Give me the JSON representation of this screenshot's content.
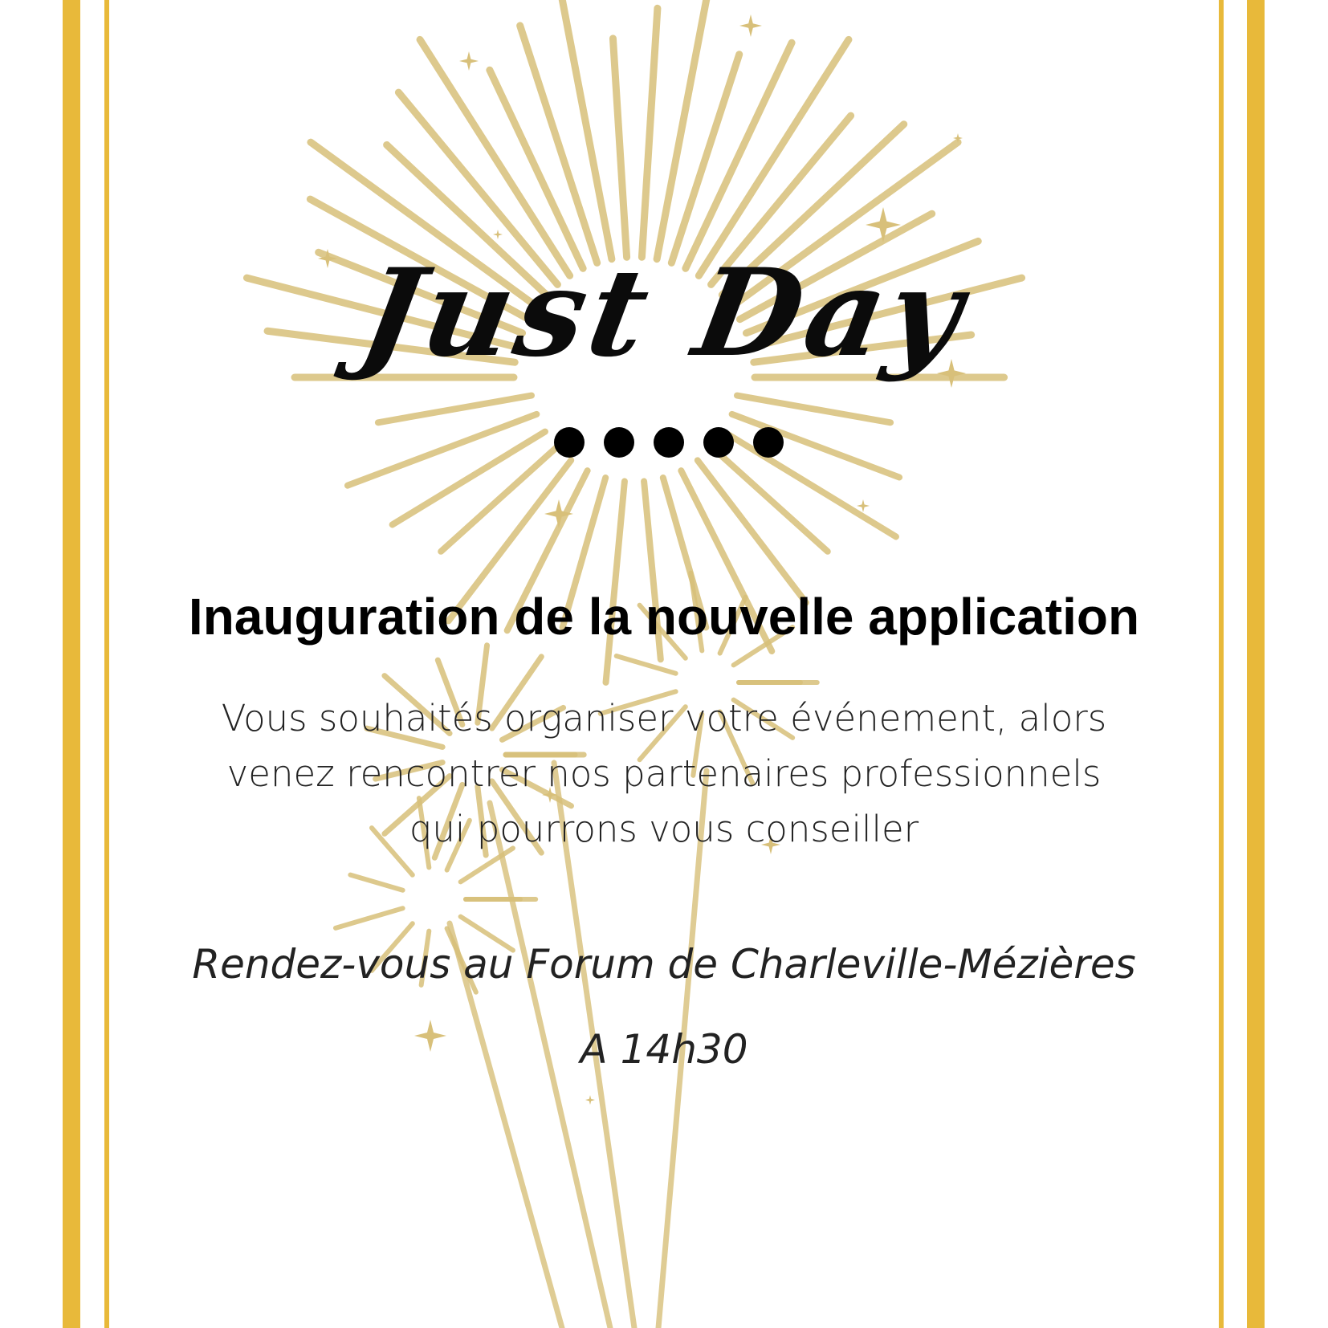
{
  "colors": {
    "frame": "#e8b93a",
    "gold": "#d8c07a",
    "text": "#000000"
  },
  "brand": "Just Day",
  "title": "Inauguration de la nouvelle application",
  "description": [
    "Vous souhaités organiser votre événement, alors",
    "venez rencontrer nos partenaires professionnels",
    "qui pourrons vous conseiller"
  ],
  "venue": "Rendez-vous au Forum de Charleville-Mézières",
  "time": "A 14h30",
  "decor": {
    "icon": "fireworks-icon",
    "dots_count": 5
  }
}
